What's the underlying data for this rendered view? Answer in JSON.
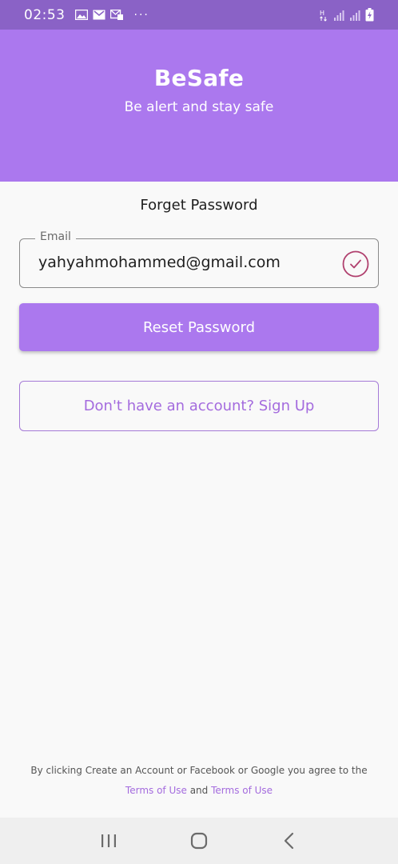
{
  "status_bar": {
    "time": "02:53",
    "left_icons": [
      "gallery-icon",
      "mail-icon",
      "email-icon"
    ],
    "overflow": "···",
    "right_icons": [
      "hplus-data-icon",
      "signal-icon",
      "signal-icon",
      "battery-charging-icon"
    ]
  },
  "header": {
    "title": "BeSafe",
    "tagline": "Be alert and stay safe"
  },
  "page": {
    "title": "Forget Password"
  },
  "form": {
    "email_label": "Email",
    "email_value": "yahyahmohammed@gmail.com",
    "reset_label": "Reset Password",
    "signup_label": "Don't have an account? Sign Up"
  },
  "footer": {
    "note": "By clicking Create an Account or Facebook or Google you agree to the",
    "link1": "Terms of Use",
    "and": "and",
    "link2": "Terms of Use"
  },
  "colors": {
    "header": "#ab78ee",
    "status_bar": "#8a62c6",
    "accent_text": "#a46bde",
    "check": "#b0406e"
  },
  "nav_bar": {
    "icons": [
      "recent-apps-icon",
      "home-icon",
      "back-icon"
    ]
  }
}
